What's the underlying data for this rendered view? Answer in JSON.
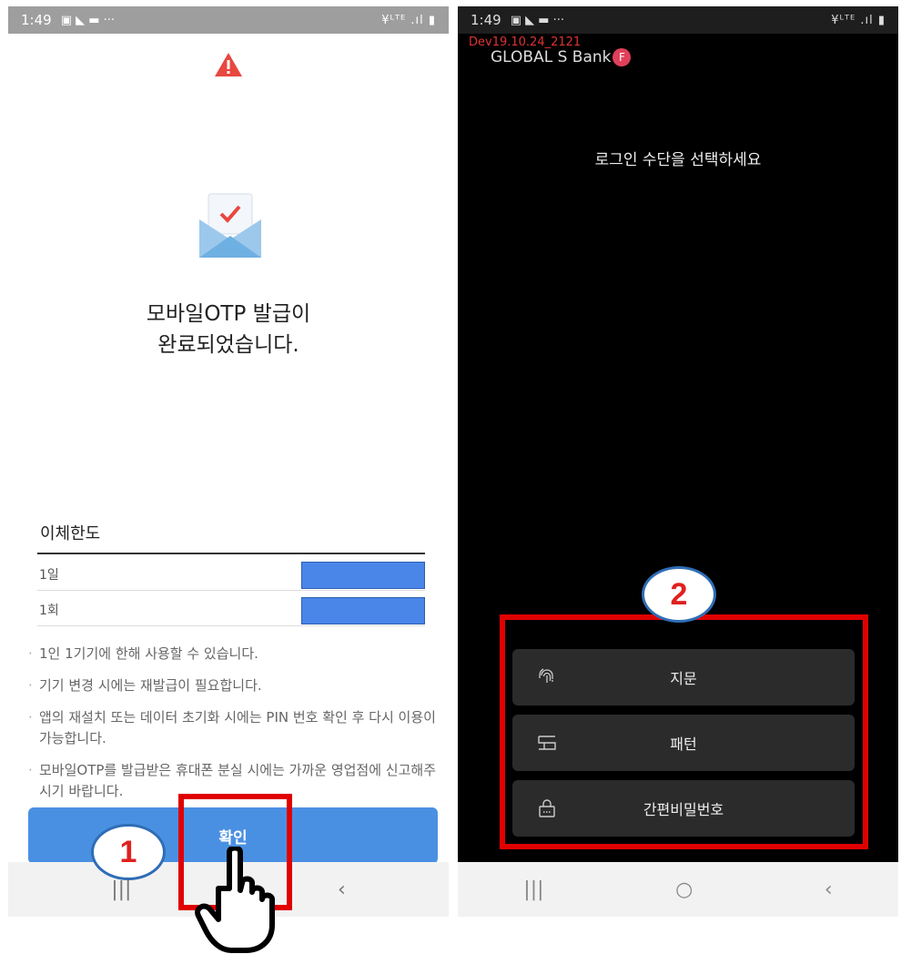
{
  "left_screen": {
    "status": {
      "time": "1:49",
      "icons": "▣ ◣ ▬ ···",
      "right": "¥ᴸᵀᴱ .ıl ▮"
    },
    "title_line1": "모바일OTP 발급이",
    "title_line2": "완료되었습니다.",
    "limit": {
      "heading": "이체한도",
      "rows": [
        {
          "label": "1일"
        },
        {
          "label": "1회"
        }
      ]
    },
    "notes": [
      "1인 1기기에 한해 사용할 수 있습니다.",
      "기기 변경 시에는 재발급이 필요합니다.",
      "앱의 재설치 또는 데이터 초기화 시에는 PIN 번호 확인 후 다시 이용이 가능합니다.",
      "모바일OTP를 발급받은 휴대폰 분실 시에는 가까운 영업점에 신고해주시기 바랍니다."
    ],
    "confirm_label": "확인",
    "nav": {
      "recent": "|||",
      "back": "‹"
    }
  },
  "right_screen": {
    "status": {
      "time": "1:49",
      "icons": "▣ ◣ ▬ ···",
      "right": "¥ᴸᵀᴱ .ıl ▮"
    },
    "dev_label": "Dev19.10.24_2121",
    "bank_name": "GLOBAL S Bank",
    "bank_badge": "F",
    "login_prompt": "로그인 수단을 선택하세요",
    "options": [
      {
        "label": "지문",
        "icon": "fingerprint-icon"
      },
      {
        "label": "패턴",
        "icon": "pattern-icon"
      },
      {
        "label": "간편비밀번호",
        "icon": "lock-icon"
      }
    ],
    "nav": {
      "recent": "|||",
      "home": "○",
      "back": "‹"
    }
  },
  "annotations": {
    "marker1": "1",
    "marker2": "2"
  },
  "colors": {
    "confirm_button": "#4a90e2",
    "highlight_red": "#e00000",
    "marker_border": "#2f6db5",
    "marker_text": "#e02020"
  }
}
